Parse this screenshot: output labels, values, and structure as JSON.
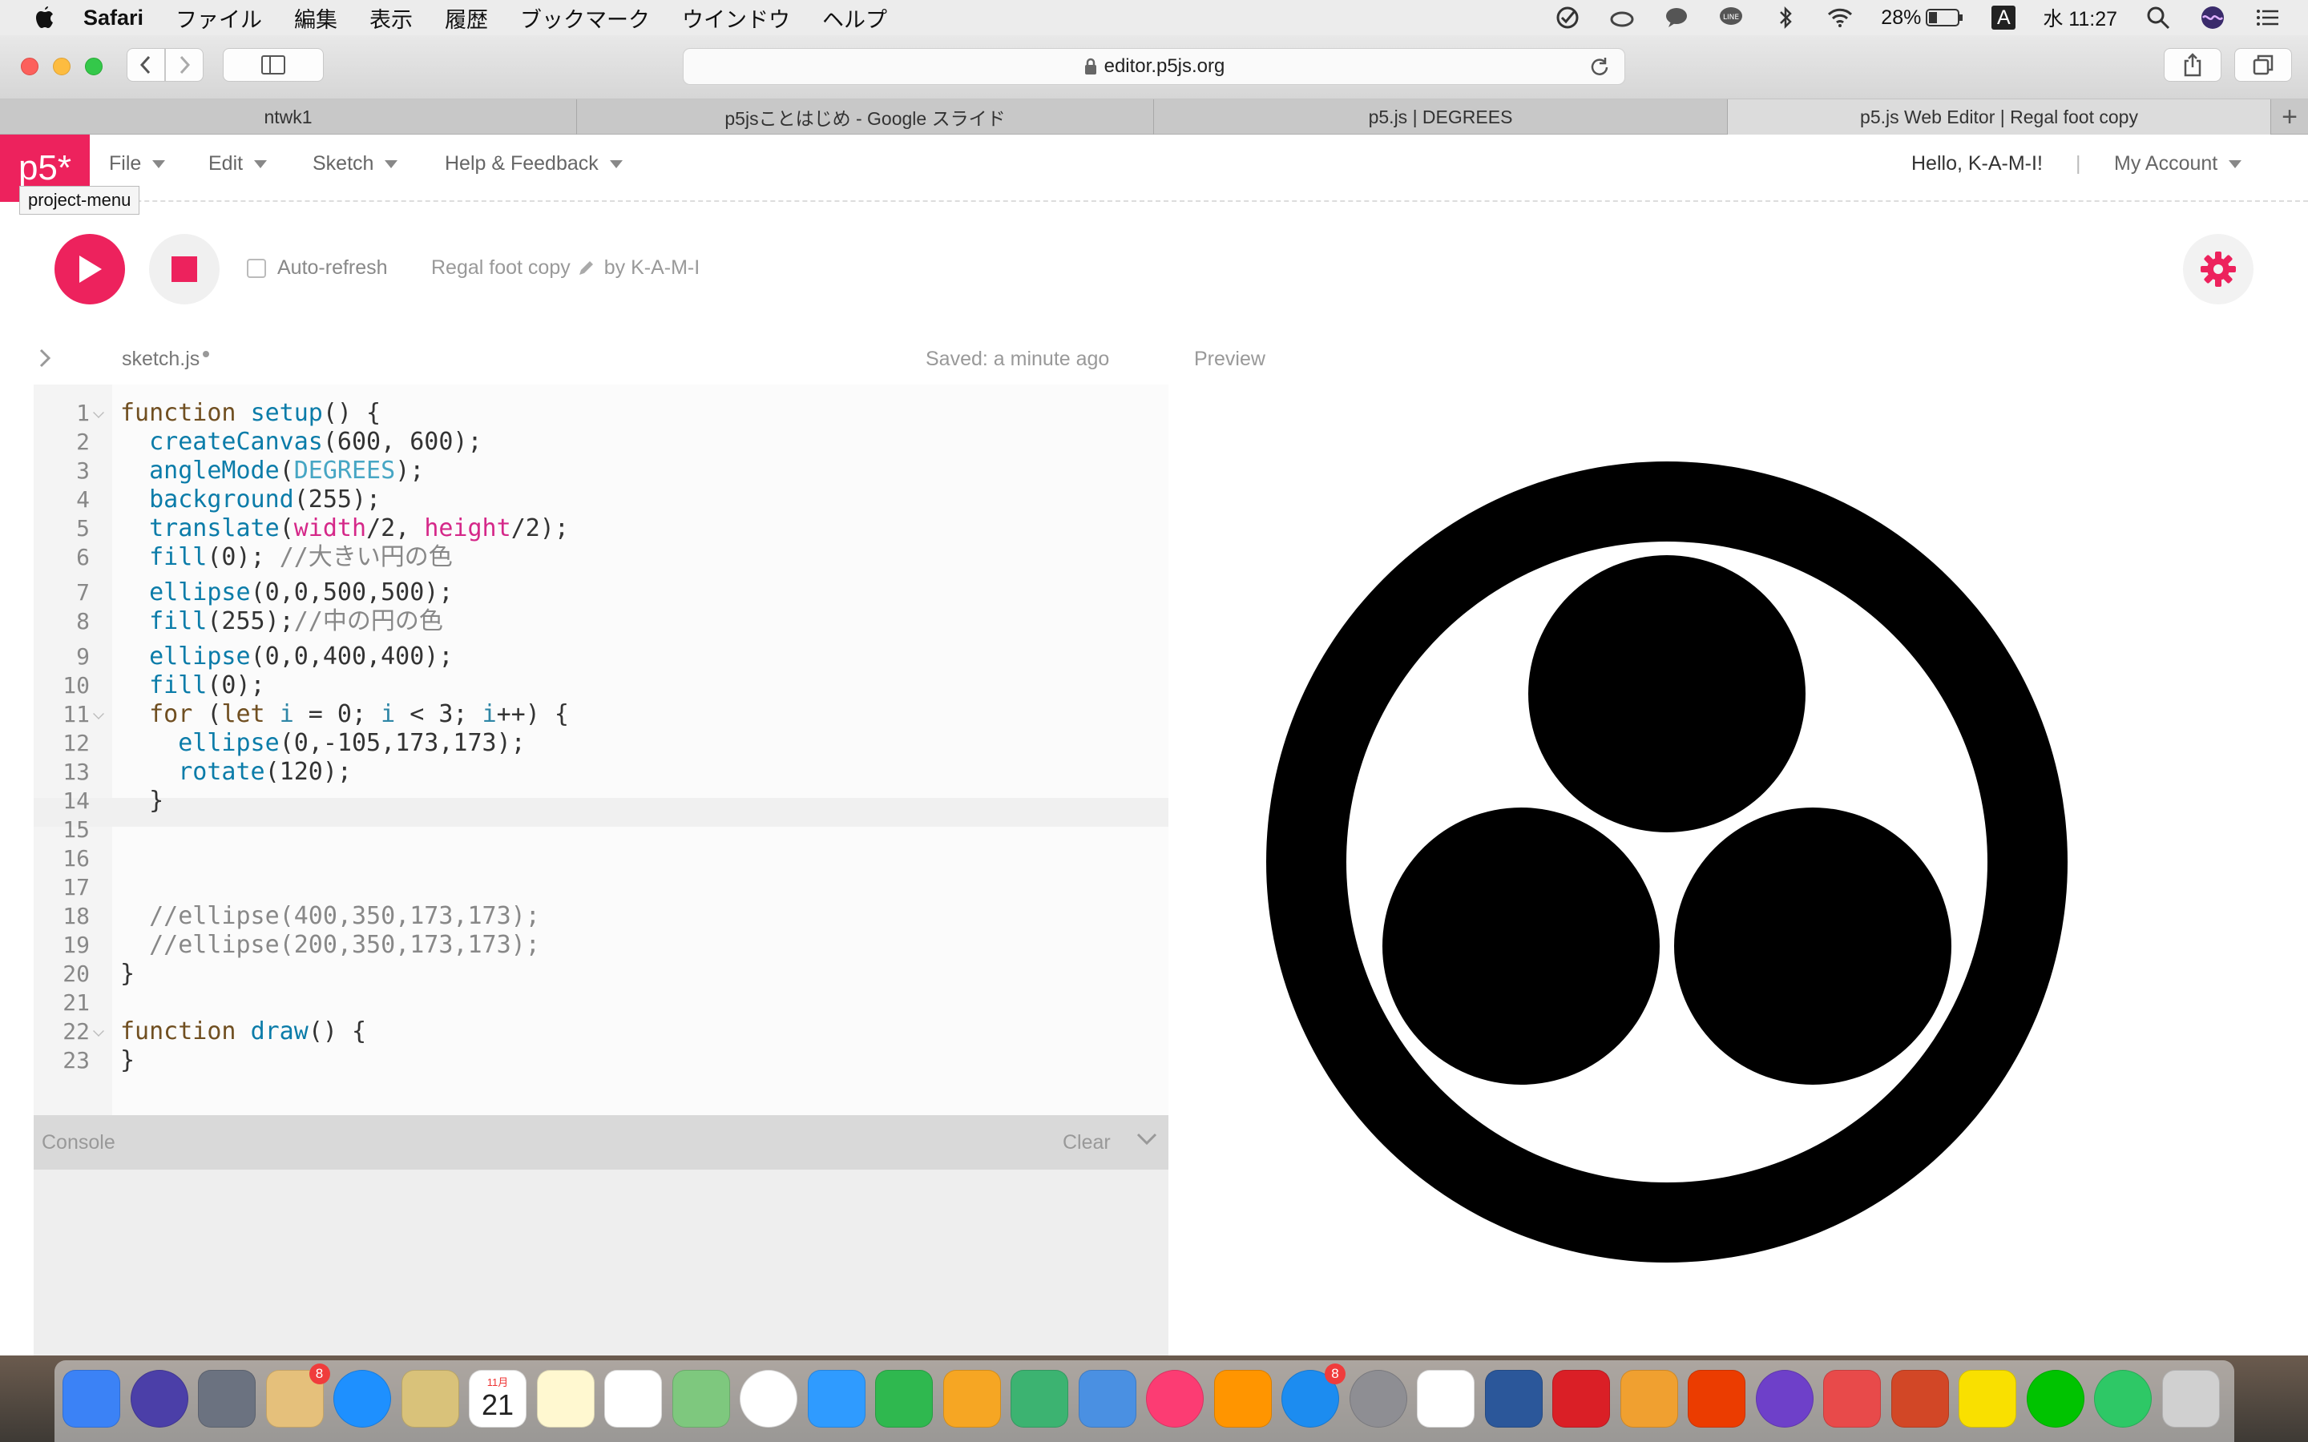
{
  "macos_menubar": {
    "app_name": "Safari",
    "menu_items": [
      "ファイル",
      "編集",
      "表示",
      "履歴",
      "ブックマーク",
      "ウインドウ",
      "ヘルプ"
    ],
    "status": {
      "battery": "28%",
      "input": "A",
      "clock": "水 11:27"
    }
  },
  "safari": {
    "url": "editor.p5js.org",
    "tabs": [
      {
        "label": "ntwk1",
        "active": false
      },
      {
        "label": "p5jsことはじめ - Google スライド",
        "active": false
      },
      {
        "label": "p5.js | DEGREES",
        "active": false
      },
      {
        "label": "p5.js Web Editor | Regal foot copy",
        "active": true
      }
    ]
  },
  "p5_nav": {
    "logo_text": "p5*",
    "menu": [
      "File",
      "Edit",
      "Sketch",
      "Help & Feedback"
    ],
    "greeting": "Hello, K-A-M-I!",
    "separator": "|",
    "account": "My Account",
    "tooltip": "project-menu"
  },
  "p5_toolbar": {
    "auto_refresh_label": "Auto-refresh",
    "project_name": "Regal foot copy",
    "author": "by K-A-M-I",
    "accent_color": "#ed225d"
  },
  "editor": {
    "file_name": "sketch.js",
    "saved_status": "Saved: a minute ago",
    "preview_label": "Preview",
    "highlighted_line": 13,
    "lines": [
      {
        "n": "1",
        "text": "function setup() {"
      },
      {
        "n": "2",
        "text": "  createCanvas(600, 600);"
      },
      {
        "n": "3",
        "text": "  angleMode(DEGREES);"
      },
      {
        "n": "4",
        "text": "  background(255);"
      },
      {
        "n": "5",
        "text": "  translate(width/2, height/2);"
      },
      {
        "n": "6",
        "text": "  fill(0); //大きい円の色"
      },
      {
        "n": "7",
        "text": "  ellipse(0,0,500,500);"
      },
      {
        "n": "8",
        "text": "  fill(255);//中の円の色"
      },
      {
        "n": "9",
        "text": "  ellipse(0,0,400,400);"
      },
      {
        "n": "10",
        "text": "  fill(0);"
      },
      {
        "n": "11",
        "text": "  for (let i = 0; i < 3; i++) {"
      },
      {
        "n": "12",
        "text": "    ellipse(0,-105,173,173);"
      },
      {
        "n": "13",
        "text": "    rotate(120);"
      },
      {
        "n": "14",
        "text": "  }"
      },
      {
        "n": "15",
        "text": ""
      },
      {
        "n": "16",
        "text": ""
      },
      {
        "n": "17",
        "text": ""
      },
      {
        "n": "18",
        "text": "  //ellipse(400,350,173,173);"
      },
      {
        "n": "19",
        "text": "  //ellipse(200,350,173,173);"
      },
      {
        "n": "20",
        "text": "}"
      },
      {
        "n": "21",
        "text": ""
      },
      {
        "n": "22",
        "text": "function draw() {"
      },
      {
        "n": "23",
        "text": "}"
      }
    ]
  },
  "console": {
    "title": "Console",
    "clear_label": "Clear"
  },
  "dock": {
    "apps": [
      "finder-icon",
      "siri-icon",
      "launchpad-icon",
      "mail-bird-icon",
      "safari-icon",
      "notes-icon",
      "calendar-icon",
      "notes-pad-icon",
      "reminders-icon",
      "maps-icon",
      "photos-icon",
      "messages-icon",
      "facetime-icon",
      "pages-icon",
      "numbers-icon",
      "keynote-icon",
      "itunes-icon",
      "ibooks-icon",
      "appstore-icon",
      "system-preferences-icon",
      "sketch-icon",
      "word-icon",
      "creative-cloud-icon",
      "fusion360-icon",
      "office-icon",
      "github-icon",
      "airmail-icon",
      "powerpoint-icon",
      "kakaotalk-icon",
      "line-icon",
      "atom-icon",
      "trash-icon"
    ],
    "badges": {
      "mail-bird-icon": "8",
      "appstore-icon": "8"
    },
    "calendar_day": "21",
    "calendar_month": "11月"
  }
}
